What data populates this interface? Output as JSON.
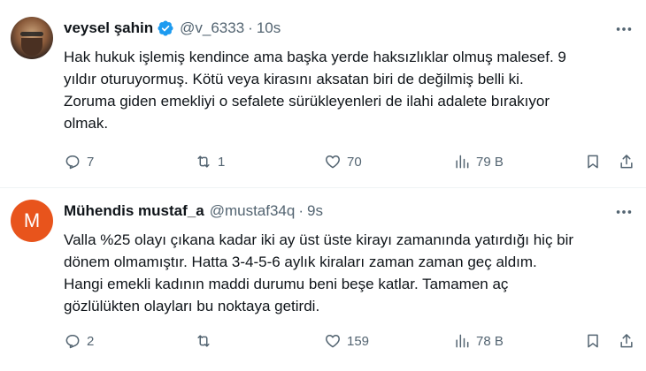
{
  "tweets": [
    {
      "author_name": "veysel şahin",
      "handle": "@v_6333",
      "separator": "·",
      "time": "10s",
      "verified": true,
      "avatar_icon": "user-photo",
      "text_lines": [
        "Hak hukuk işlemiş kendince ama başka yerde haksızlıklar olmuş malesef. 9",
        "yıldır oturuyormuş. Kötü veya kirasını aksatan biri de değilmiş belli ki.",
        "Zoruma giden emekliyi o sefalete sürükleyenleri de ilahi adalete bırakıyor",
        "olmak."
      ],
      "replies": "7",
      "retweets": "1",
      "likes": "70",
      "views": "79 B"
    },
    {
      "author_name": "Mühendis mustaf_a",
      "handle": "@mustaf34q",
      "separator": "·",
      "time": "9s",
      "verified": false,
      "avatar_letter": "M",
      "text_lines": [
        "Valla %25 olayı çıkana kadar iki ay üst üste kirayı zamanında yatırdığı hiç bir",
        "dönem olmamıştır. Hatta 3-4-5-6 aylık kiraları zaman zaman geç aldım.",
        "Hangi emekli kadının maddi durumu beni beşe katlar. Tamamen aç",
        "gözlülükten olayları bu noktaya getirdi."
      ],
      "replies": "2",
      "retweets": "",
      "likes": "159",
      "views": "78 B"
    }
  ],
  "colors": {
    "text": "#0f1419",
    "secondary": "#536471",
    "verified_blue": "#1d9bf0",
    "avatar_orange": "#e8541c",
    "divider": "#eff3f4"
  }
}
